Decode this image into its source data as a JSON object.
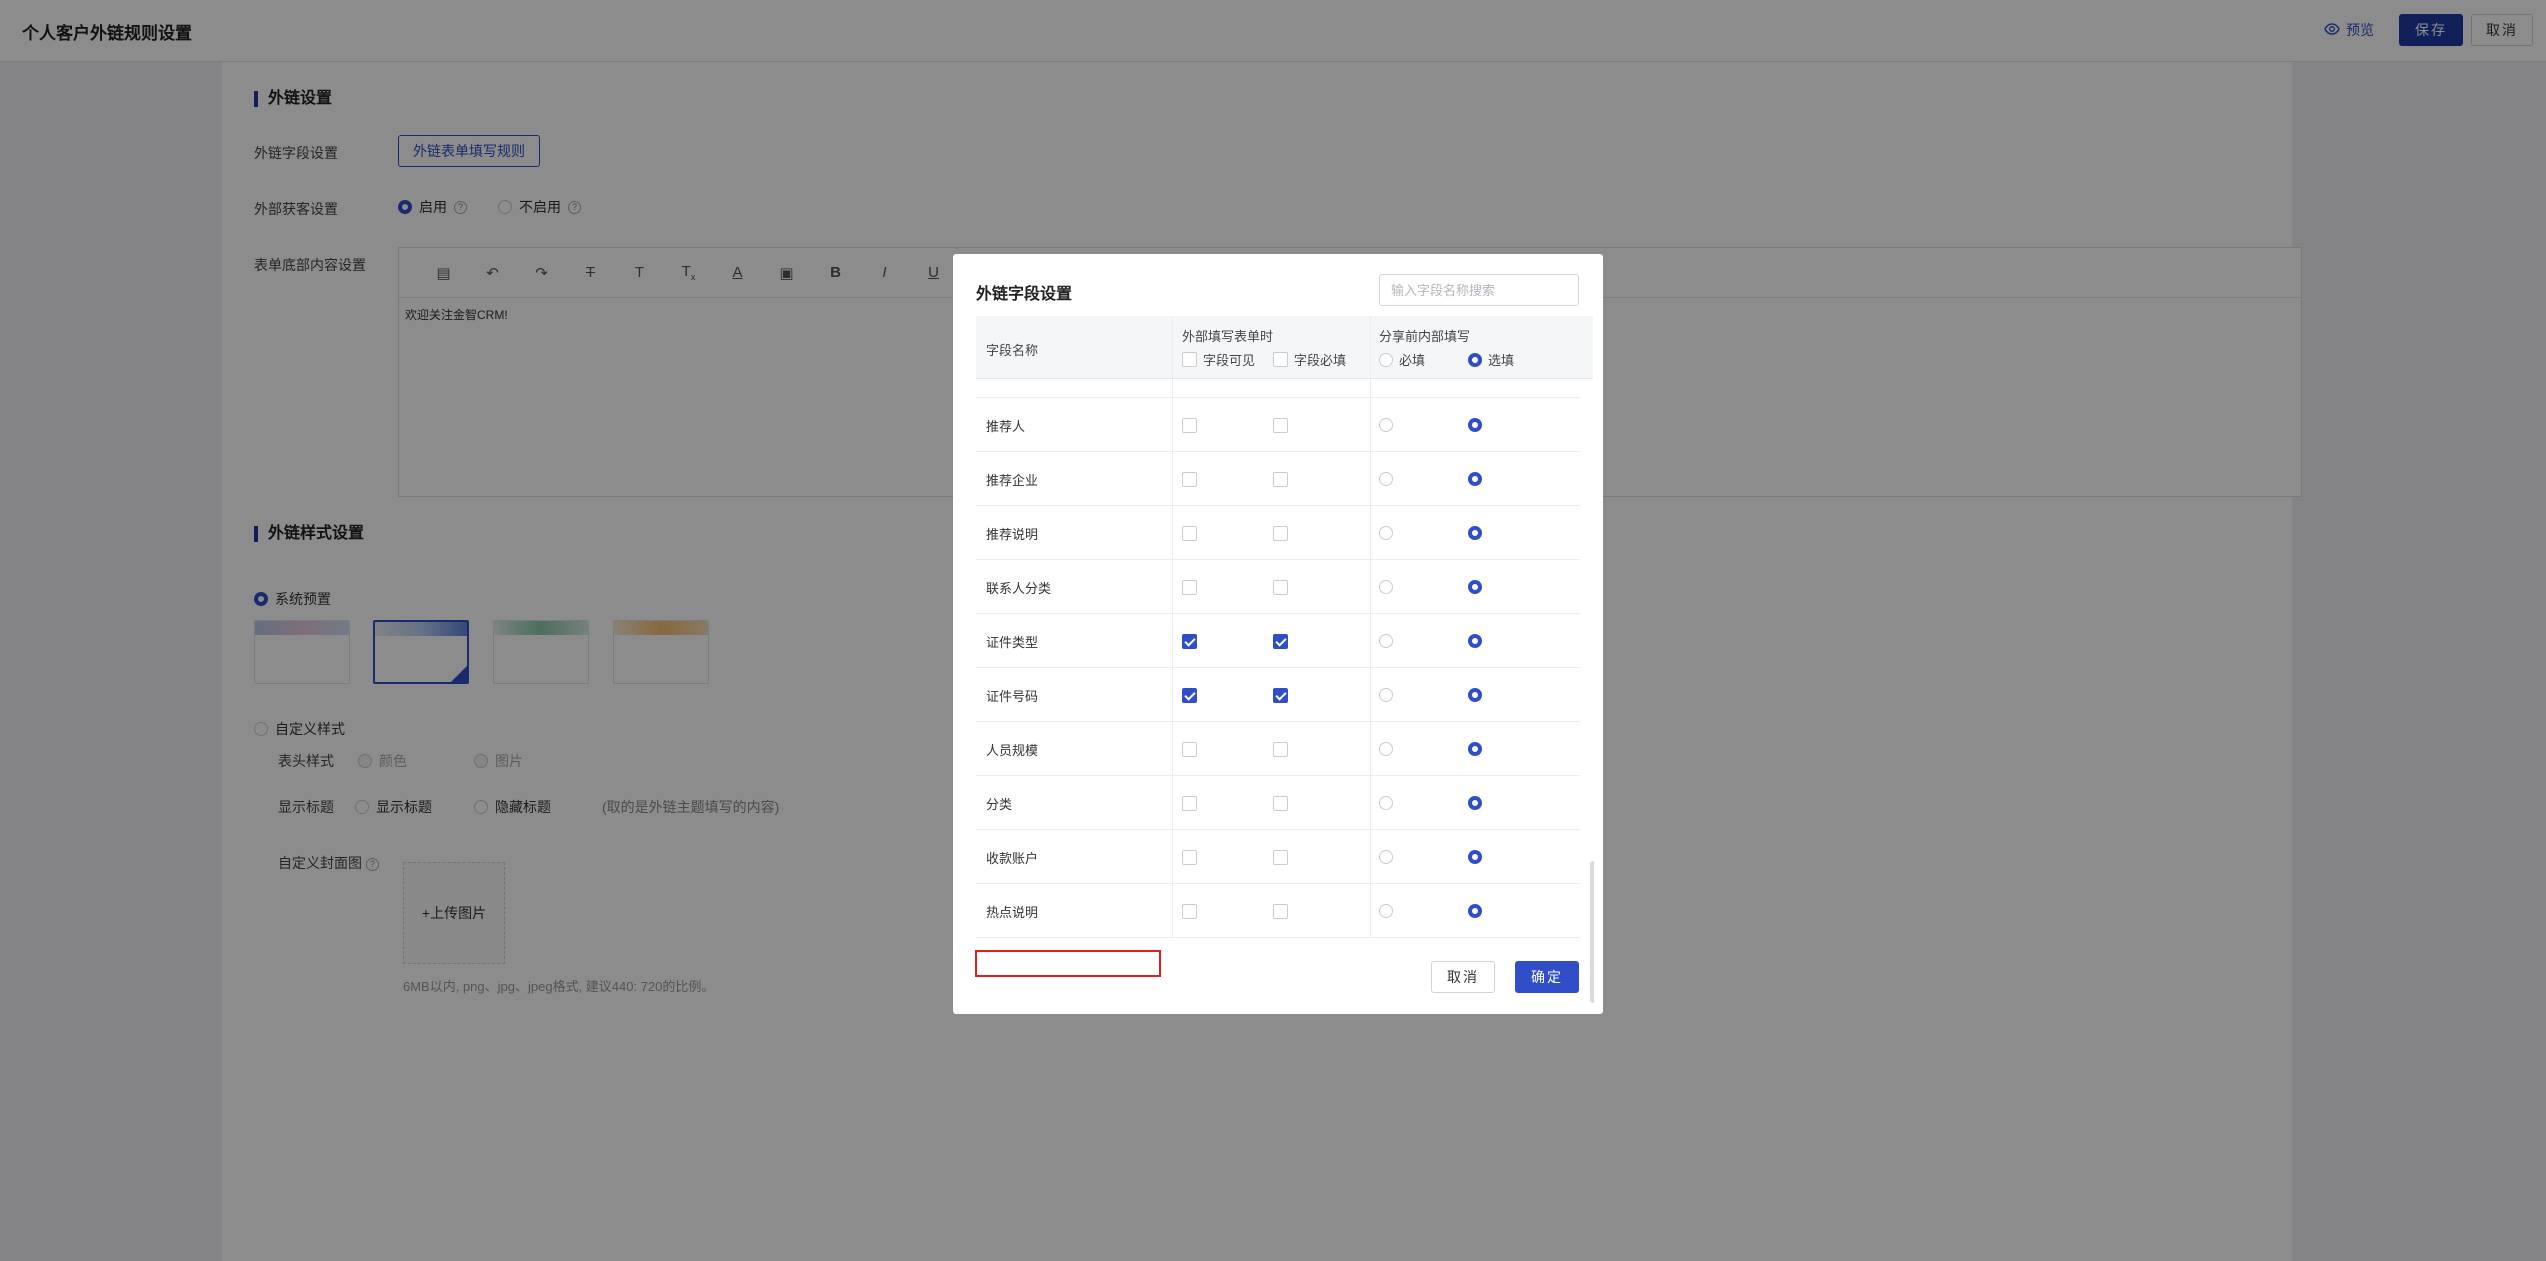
{
  "header": {
    "title": "个人客户外链规则设置",
    "preview_label": "预览",
    "save_label": "保存",
    "cancel_label": "取消"
  },
  "section_link": {
    "title": "外链设置",
    "field_setting_label": "外链字段设置",
    "field_rule_button": "外链表单填写规则",
    "acquire_label": "外部获客设置",
    "acquire_on": "启用",
    "acquire_off": "不启用",
    "footer_label": "表单底部内容设置",
    "editor_content": "欢迎关注金智CRM!"
  },
  "section_style": {
    "title": "外链样式设置",
    "preset_label": "系统预置",
    "custom_label": "自定义样式",
    "header_style_label": "表头样式",
    "header_color": "颜色",
    "header_image": "图片",
    "display_title_label": "显示标题",
    "show_title": "显示标题",
    "hide_title": "隐藏标题",
    "title_hint": "(取的是外链主题填写的内容)",
    "cover_label": "自定义封面图",
    "upload_label": "+上传图片",
    "upload_hint": "6MB以内, png、jpg、jpeg格式, 建议440: 720的比例。"
  },
  "modal": {
    "title": "外链字段设置",
    "search_placeholder": "输入字段名称搜索",
    "col_name": "字段名称",
    "col_external": "外部填写表单时",
    "col_visible": "字段可见",
    "col_required": "字段必填",
    "col_internal": "分享前内部填写",
    "col_must": "必填",
    "col_optional": "选填",
    "cancel_label": "取消",
    "ok_label": "确定",
    "rows": [
      {
        "name": "推荐人",
        "visible": false,
        "required": false,
        "must": false
      },
      {
        "name": "推荐企业",
        "visible": false,
        "required": false,
        "must": false
      },
      {
        "name": "推荐说明",
        "visible": false,
        "required": false,
        "must": false
      },
      {
        "name": "联系人分类",
        "visible": false,
        "required": false,
        "must": false
      },
      {
        "name": "证件类型",
        "visible": true,
        "required": true,
        "must": false
      },
      {
        "name": "证件号码",
        "visible": true,
        "required": true,
        "must": false
      },
      {
        "name": "人员规模",
        "visible": false,
        "required": false,
        "must": false
      },
      {
        "name": "分类",
        "visible": false,
        "required": false,
        "must": false
      },
      {
        "name": "收款账户",
        "visible": false,
        "required": false,
        "must": false
      },
      {
        "name": "热点说明",
        "visible": false,
        "required": false,
        "must": false
      }
    ]
  },
  "colors": {
    "primary": "#2f4ec7",
    "save_button": "#1e3a9e",
    "highlight_box": "#e02020"
  }
}
